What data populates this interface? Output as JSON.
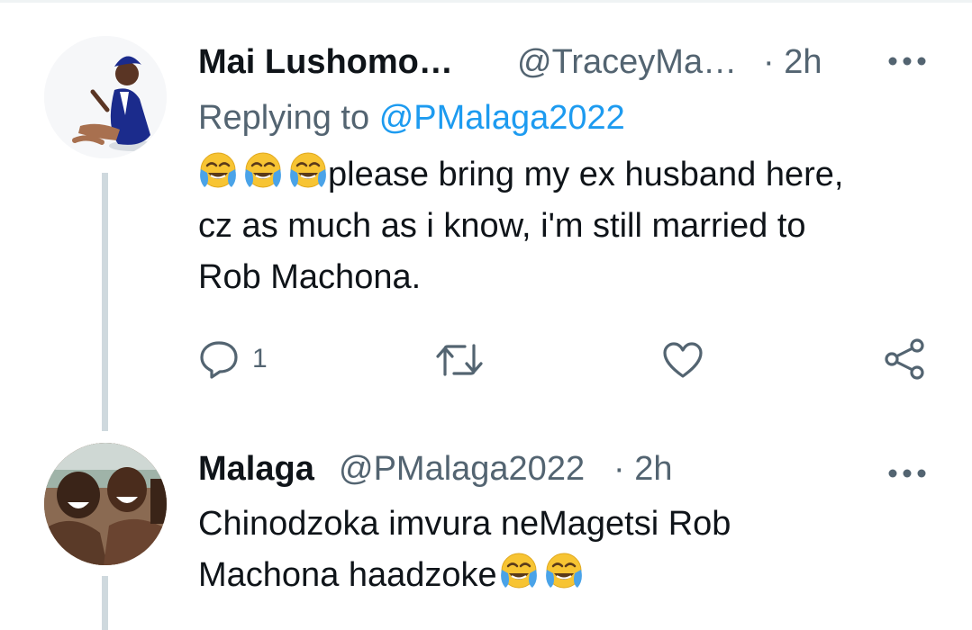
{
  "tweets": [
    {
      "name": "Mai Lushomo…",
      "handle": "@TraceyMa…",
      "time": "· 2h",
      "more_icon": "more-horizontal-icon",
      "replying_prefix": "Replying to",
      "replying_mention": "@PMalaga2022",
      "lines": [
        "please bring my ex husband here,",
        "cz as much as i know, i'm still married to",
        "Rob Machona."
      ],
      "leading_emoji": [
        "face-with-tears-of-joy",
        "face-with-tears-of-joy",
        "face-with-tears-of-joy"
      ],
      "actions": {
        "reply_count": "1",
        "reply_icon": "reply-icon",
        "retweet_icon": "retweet-icon",
        "like_icon": "heart-icon",
        "share_icon": "share-icon"
      }
    },
    {
      "name": "Malaga",
      "handle": "@PMalaga2022",
      "time": "· 2h",
      "more_icon": "more-horizontal-icon",
      "lines": [
        "Chinodzoka imvura neMagetsi Rob",
        "Machona haadzoke"
      ],
      "trailing_emoji": [
        "face-with-tears-of-joy",
        "face-with-tears-of-joy"
      ]
    }
  ],
  "colors": {
    "text": "#0f1419",
    "secondary": "#536471",
    "link": "#1d9bf0",
    "thread_line": "#cfd9de"
  }
}
